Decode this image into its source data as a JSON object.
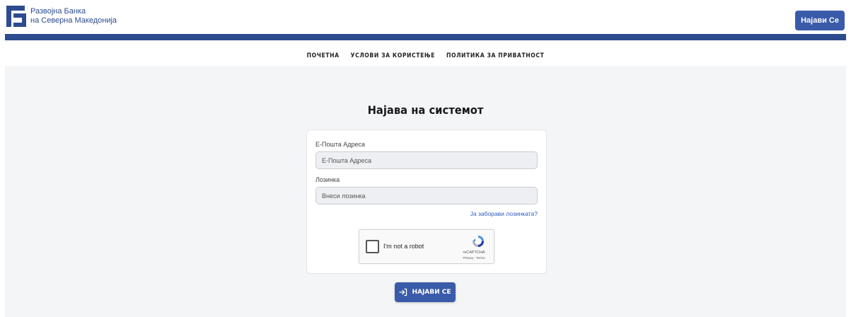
{
  "header": {
    "logo_line1": "Развојна Банка",
    "logo_line2": "на Северна Македонија",
    "login_button": "Најави Се"
  },
  "nav": {
    "items": [
      {
        "label": "ПОЧЕТНА"
      },
      {
        "label": "УСЛОВИ ЗА КОРИСТЕЊЕ"
      },
      {
        "label": "ПОЛИТИКА ЗА ПРИВАТНОСТ"
      }
    ]
  },
  "main": {
    "title": "Најава на системот",
    "email_label": "Е-Пошта Адреса",
    "email_placeholder": "Е-Пошта Адреса",
    "password_label": "Лозинка",
    "password_placeholder": "Внеси лозинка",
    "forgot_link": "Ја заборави лозинката?",
    "captcha": {
      "text": "I'm not a robot",
      "brand": "reCAPTCHA",
      "links": "Privacy - Terms"
    },
    "submit_label": "НАЈАВИ СЕ"
  },
  "colors": {
    "brand_blue": "#2d4b8e",
    "button_blue": "#3a5ba9",
    "link_blue": "#2d5bb9"
  }
}
